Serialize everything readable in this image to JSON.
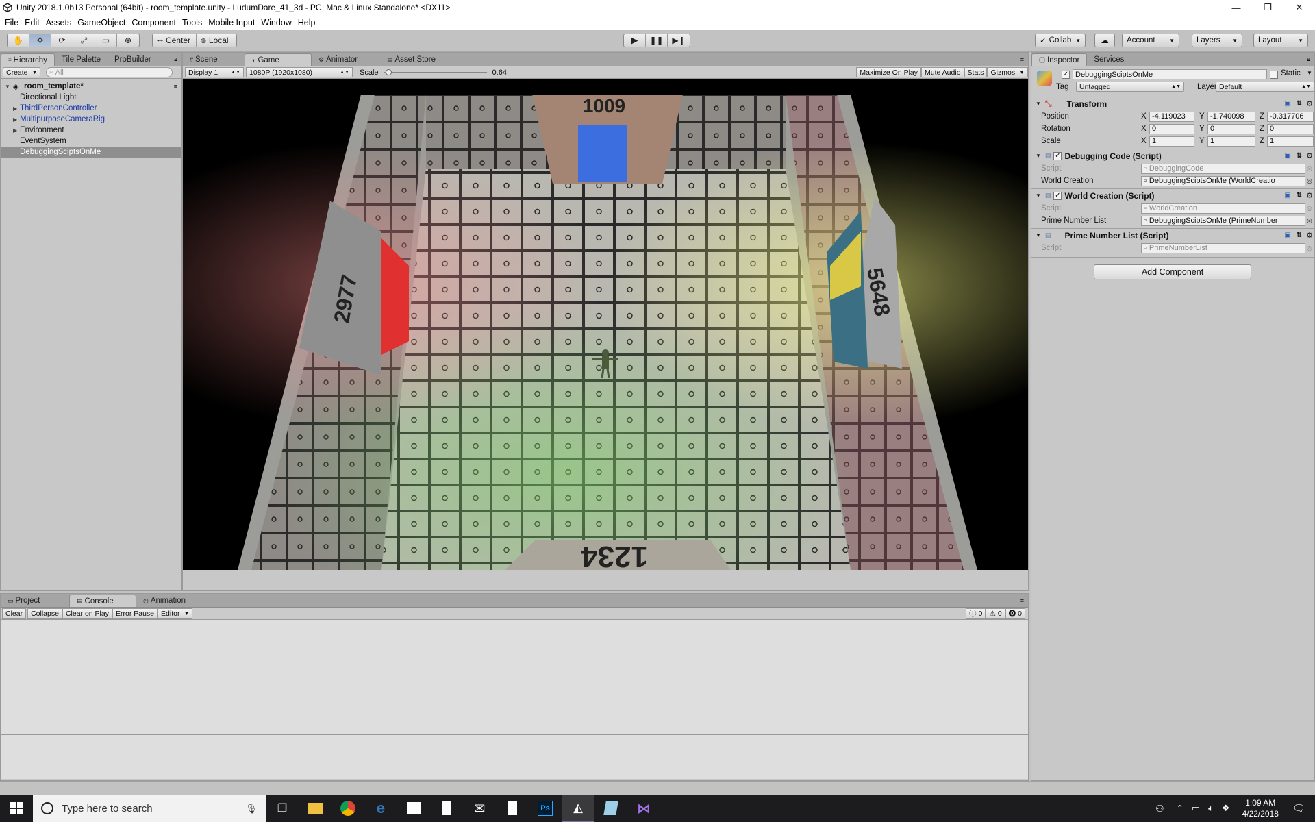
{
  "window": {
    "title": "Unity 2018.1.0b13 Personal (64bit) - room_template.unity - LudumDare_41_3d - PC, Mac & Linux Standalone* <DX11>",
    "controls": [
      "—",
      "❐",
      "✕"
    ]
  },
  "menu": [
    "File",
    "Edit",
    "Assets",
    "GameObject",
    "Component",
    "Tools",
    "Mobile Input",
    "Window",
    "Help"
  ],
  "toolbar": {
    "transform_tools": [
      "hand-icon",
      "move-icon",
      "rotate-icon",
      "scale-icon",
      "rect-icon",
      "transform-icon"
    ],
    "pivot_center": "Center",
    "pivot_local": "Local",
    "collab": "Collab",
    "account": "Account",
    "layers": "Layers",
    "layout": "Layout"
  },
  "hierarchy": {
    "tabs": [
      "Hierarchy",
      "Tile Palette",
      "ProBuilder"
    ],
    "create": "Create",
    "search_placeholder": "All",
    "scene": "room_template*",
    "items": [
      {
        "label": "Directional Light",
        "color": "#111111"
      },
      {
        "label": "ThirdPersonController",
        "color": "#1a3aa7"
      },
      {
        "label": "MultipurposeCameraRig",
        "color": "#1a3aa7"
      },
      {
        "label": "Environment",
        "color": "#111111"
      },
      {
        "label": "EventSystem",
        "color": "#111111"
      },
      {
        "label": "DebuggingSciptsOnMe",
        "color": "#ffffff"
      }
    ]
  },
  "gameview": {
    "tabs": [
      "Scene",
      "Game",
      "Animator",
      "Asset Store"
    ],
    "display": "Display 1",
    "resolution": "1080P (1920x1080)",
    "scale_label": "Scale",
    "scale_value": "0.64:",
    "maximize": "Maximize On Play",
    "mute": "Mute Audio",
    "stats": "Stats",
    "gizmos": "Gizmos",
    "room_numbers": {
      "top": "1009",
      "left": "2977",
      "right": "5648",
      "bottom": "1234"
    }
  },
  "inspector": {
    "tabs": [
      "Inspector",
      "Services"
    ],
    "object_name": "DebuggingSciptsOnMe",
    "static_label": "Static",
    "tag_label": "Tag",
    "tag_value": "Untagged",
    "layer_label": "Layer",
    "layer_value": "Default",
    "transform": {
      "title": "Transform",
      "position_label": "Position",
      "rotation_label": "Rotation",
      "scale_label": "Scale",
      "position": {
        "x": "-4.119023",
        "y": "-1.740098",
        "z": "-0.317706"
      },
      "rotation": {
        "x": "0",
        "y": "0",
        "z": "0"
      },
      "scale": {
        "x": "1",
        "y": "1",
        "z": "1"
      }
    },
    "components": [
      {
        "title": "Debugging Code (Script)",
        "script": "DebuggingCode",
        "field_label": "World Creation",
        "field_value": "DebuggingSciptsOnMe (WorldCreatio"
      },
      {
        "title": "World Creation (Script)",
        "script": "WorldCreation",
        "field_label": "Prime Number List",
        "field_value": "DebuggingSciptsOnMe (PrimeNumber"
      },
      {
        "title": "Prime Number List (Script)",
        "script": "PrimeNumberList"
      }
    ],
    "script_label": "Script",
    "add_component": "Add Component"
  },
  "console": {
    "tabs": [
      "Project",
      "Console",
      "Animation"
    ],
    "buttons": [
      "Clear",
      "Collapse",
      "Clear on Play",
      "Error Pause",
      "Editor"
    ],
    "counts": {
      "info": "0",
      "warn": "0",
      "error": "0"
    }
  },
  "taskbar": {
    "search_placeholder": "Type here to search",
    "time": "1:09 AM",
    "date": "4/22/2018"
  }
}
